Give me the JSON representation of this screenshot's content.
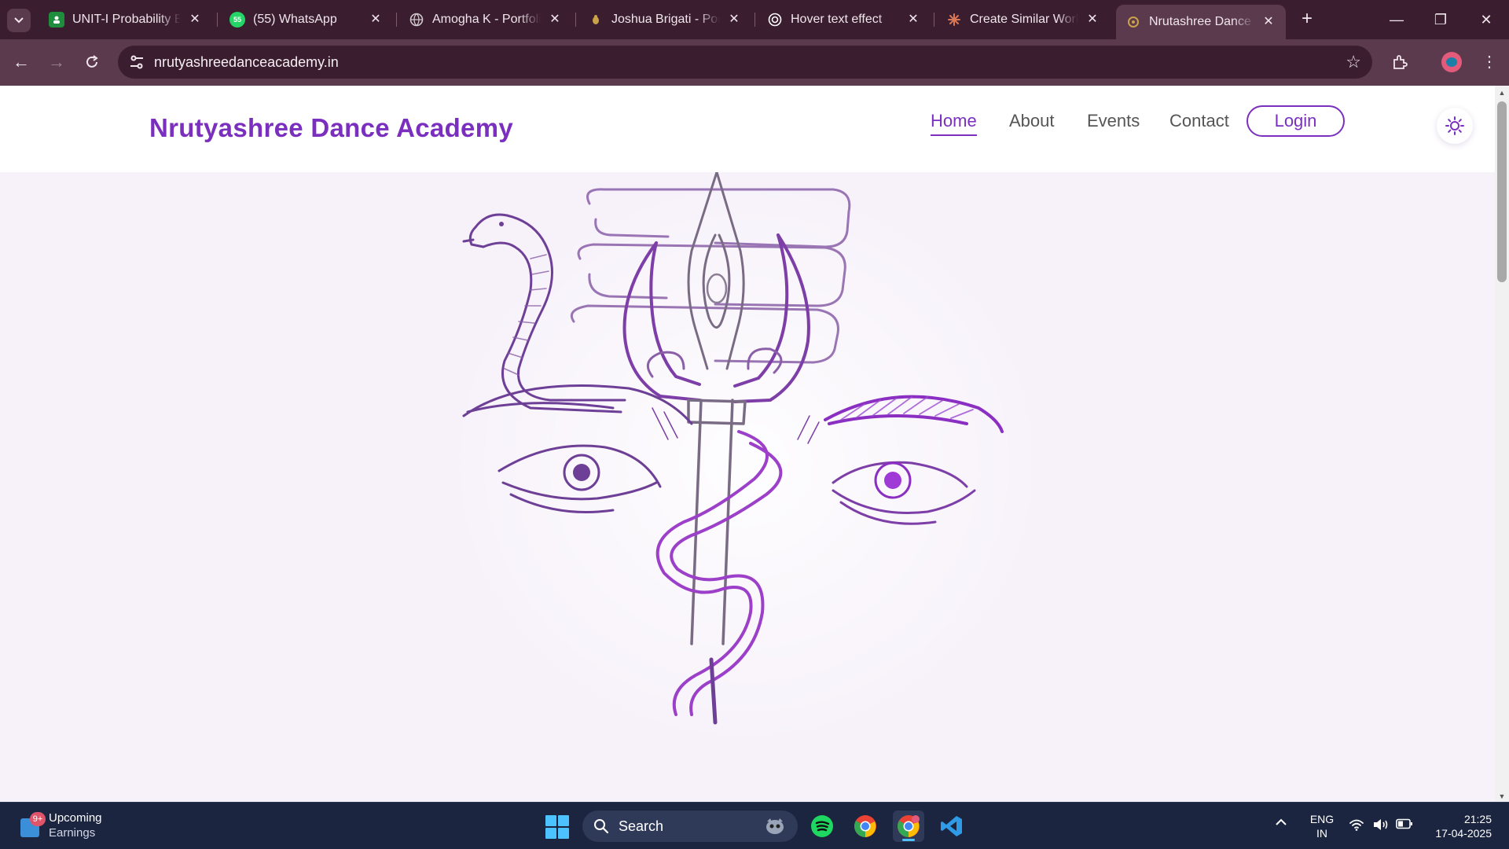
{
  "browser": {
    "tabs": [
      {
        "title": "UNIT-I Probability Ba",
        "favicon": "google-classroom-icon",
        "color": "#1e8e3e"
      },
      {
        "title": "(55) WhatsApp",
        "favicon": "whatsapp-icon",
        "color": "#25d366",
        "badge": "55"
      },
      {
        "title": "Amogha K - Portfolio",
        "favicon": "globe-icon",
        "color": "#d0c6cc"
      },
      {
        "title": "Joshua Brigati - Portf",
        "favicon": "site-favicon-icon",
        "color": "#c9a24a"
      },
      {
        "title": "Hover text effect",
        "favicon": "openai-icon",
        "color": "#ffffff"
      },
      {
        "title": "Create Similar Work I",
        "favicon": "claude-icon",
        "color": "#d97757"
      },
      {
        "title": "Nrutashree Dance Ac",
        "favicon": "site-favicon-icon",
        "color": "#c9a24a",
        "active": true
      }
    ],
    "url": "nrutyashreedanceacademy.in"
  },
  "site": {
    "brand": "Nrutyashree Dance Academy",
    "nav": [
      {
        "label": "Home",
        "active": true
      },
      {
        "label": "About",
        "active": false
      },
      {
        "label": "Events",
        "active": false
      },
      {
        "label": "Contact",
        "active": false
      }
    ],
    "login_label": "Login",
    "accent_color": "#7b2fbf"
  },
  "taskbar": {
    "weather_badge": "9+",
    "weather_title": "Upcoming",
    "weather_sub": "Earnings",
    "search_label": "Search",
    "lang_1": "ENG",
    "lang_2": "IN",
    "time": "21:25",
    "date": "17-04-2025"
  }
}
